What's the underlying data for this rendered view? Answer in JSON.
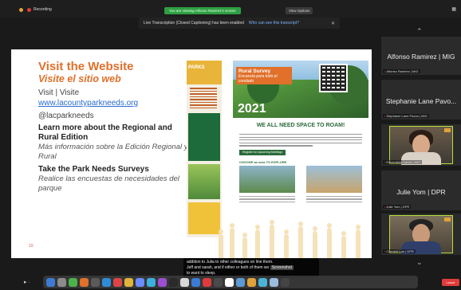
{
  "topbar": {
    "recording_label": "Recording",
    "share_banner": "You are viewing Alfonso Ramirez's screen",
    "view_options": "View Options",
    "notice_text": "Live Transcription (Closed Captioning) has been enabled",
    "notice_link": "Who can see this transcript?",
    "close": "✕"
  },
  "slide": {
    "title_en": "Visit the Website",
    "title_es": "Visite el sitio web",
    "visit_line": "Visit | Visite",
    "url": "www.lacountyparkneeds.org",
    "handle": "@lacparkneeds",
    "learn_en": "Learn more about the Regional and Rural Edition",
    "learn_es": "Más información sobre la Edición Regional y Rural",
    "take_en": "Take the Park Needs Surveys",
    "take_es": "Realice las encuestas de necesidades del parque",
    "slide_number": "10",
    "brochure_title": "PARKS",
    "survey_title": "Rural Survey",
    "survey_subtitle": "Encuesta para todo el condado",
    "survey_year": "2021",
    "survey_heading": "WE ALL NEED SPACE TO ROAM!",
    "survey_button": "Register for Upcoming Meetings",
    "survey_choose": "CHOOSE an area TO EXPLORE"
  },
  "participants": [
    {
      "name": "Alfonso Ramirez | MIG",
      "label": "Alfonso Ramirez | MIG"
    },
    {
      "name": "Stephanie Lane Pavo...",
      "label": "Stephanie Lane Pavon | MIG"
    },
    {
      "name": "",
      "label": "Esmeralda Garcia | MIG"
    },
    {
      "name": "Julie Yom | DPR",
      "label": "Julie Yom | DPR"
    },
    {
      "name": "",
      "label": "Clement Lau | DPR"
    }
  ],
  "caption": {
    "line1": "addition to Julia to other colleagues on line them.",
    "line2": "Jeff and sarah, and if either or both of them wo",
    "screenshot_label": "Screenshot",
    "line3": "to want to sleep."
  },
  "dock": {
    "leave_label": "Leave",
    "icon_colors": [
      "#3b7bd4",
      "#8c8c8c",
      "#4ab34a",
      "#e0702a",
      "#5a5a5a",
      "#2f8bd8",
      "#d44",
      "#e0b43a",
      "#6b8cff",
      "#3bb0e0",
      "#9a50d0",
      "#2a2a2a",
      "#d8d8d8",
      "#3b7bd4",
      "#e03b3b",
      "#4a4a4a",
      "#ffffff",
      "#5b9bd5",
      "#e0a23b",
      "#4ab3d8",
      "#9bd",
      "#444"
    ]
  }
}
